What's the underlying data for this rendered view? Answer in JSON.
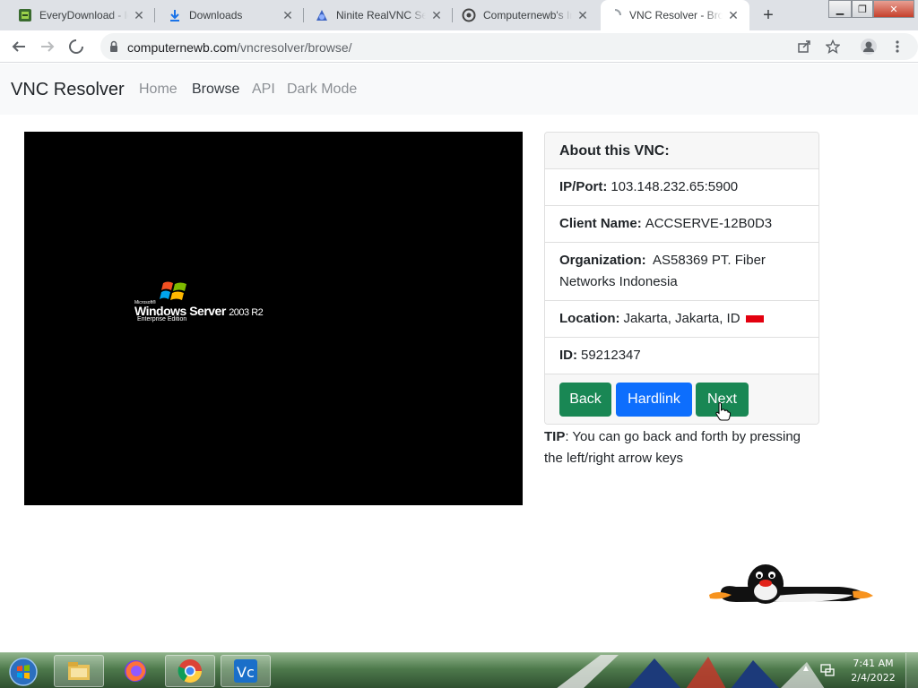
{
  "browser": {
    "tabs": [
      {
        "title": "EveryDownload - lo",
        "icon": "everydownload-favicon"
      },
      {
        "title": "Downloads",
        "icon": "download-icon"
      },
      {
        "title": "Ninite RealVNC Se",
        "icon": "ninite-favicon"
      },
      {
        "title": "Computernewb's In",
        "icon": "computernewb-favicon"
      },
      {
        "title": "VNC Resolver - Bro",
        "icon": "loading-spinner-icon"
      }
    ],
    "url": {
      "host": "computernewb.com",
      "path": "/vncresolver/browse/"
    }
  },
  "site": {
    "brand": "VNC Resolver",
    "nav": [
      "Home",
      "Browse",
      "API",
      "Dark Mode"
    ]
  },
  "screenshot": {
    "ms": "Microsoft®",
    "title": "Windows Server",
    "version": "2003 R2",
    "edition": "Enterprise Edition"
  },
  "vnc": {
    "header": "About this VNC:",
    "ip_label": "IP/Port:",
    "ip_value": "103.148.232.65:5900",
    "client_label": "Client Name:",
    "client_value": "ACCSERVE-12B0D3",
    "org_label": "Organization:",
    "org_value": "AS58369 PT. Fiber Networks Indonesia",
    "location_label": "Location:",
    "location_value": "Jakarta, Jakarta, ID",
    "id_label": "ID:",
    "id_value": "59212347",
    "buttons": {
      "back": "Back",
      "hardlink": "Hardlink",
      "next": "Next"
    }
  },
  "tip": {
    "label": "TIP",
    "text": ": You can go back and forth by pressing the left/right arrow keys"
  },
  "taskbar": {
    "apps": [
      "explorer-icon",
      "firefox-icon",
      "chrome-icon",
      "vnc-viewer-icon"
    ],
    "time": "7:41 AM",
    "date": "2/4/2022"
  },
  "colors": {
    "green": "#198754",
    "blue": "#0d6efd"
  }
}
